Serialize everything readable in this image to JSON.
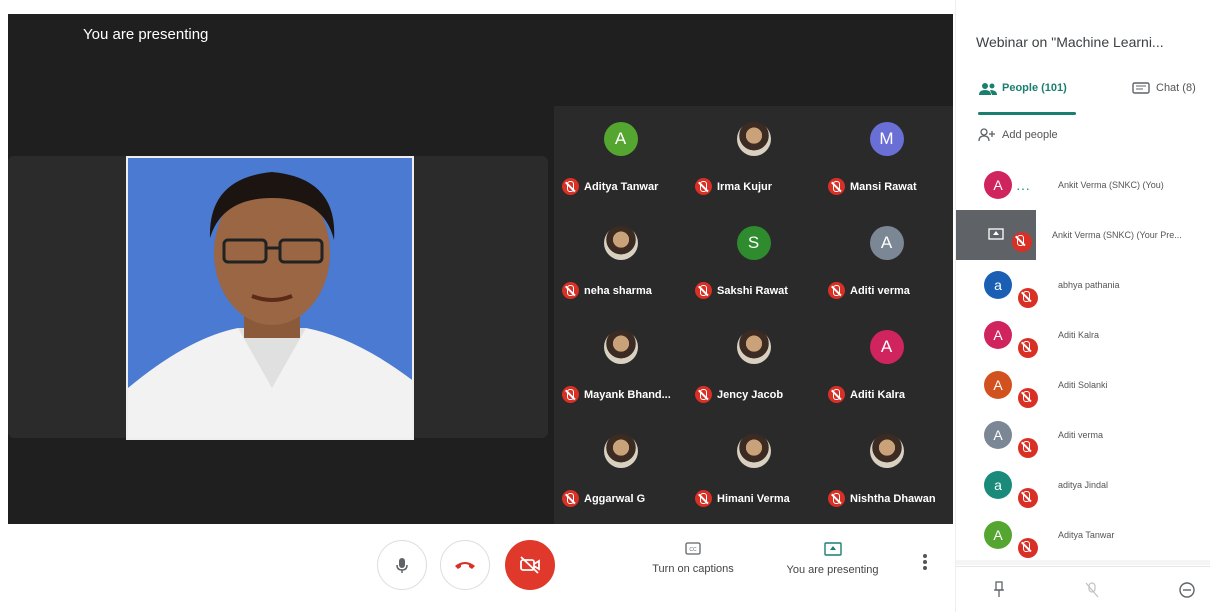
{
  "stage": {
    "presenting_label": "You are presenting",
    "tiles": [
      {
        "name": "Aditya Tanwar",
        "avatar": "A",
        "avatar_color": "#55a630",
        "photo": false
      },
      {
        "name": "Irma Kujur",
        "avatar": "",
        "avatar_color": "",
        "photo": true
      },
      {
        "name": "Mansi Rawat",
        "avatar": "M",
        "avatar_color": "#6a6fd6",
        "photo": false
      },
      {
        "name": "neha sharma",
        "avatar": "",
        "avatar_color": "",
        "photo": true
      },
      {
        "name": "Sakshi Rawat",
        "avatar": "S",
        "avatar_color": "#2e8b2e",
        "photo": false
      },
      {
        "name": "Aditi verma",
        "avatar": "A",
        "avatar_color": "#7b8794",
        "photo": false
      },
      {
        "name": "Mayank Bhand...",
        "avatar": "",
        "avatar_color": "",
        "photo": true
      },
      {
        "name": "Jency Jacob",
        "avatar": "",
        "avatar_color": "",
        "photo": true
      },
      {
        "name": "Aditi Kalra",
        "avatar": "A",
        "avatar_color": "#d0245e",
        "photo": false
      },
      {
        "name": "Aggarwal G",
        "avatar": "",
        "avatar_color": "",
        "photo": true
      },
      {
        "name": "Himani Verma",
        "avatar": "",
        "avatar_color": "",
        "photo": true
      },
      {
        "name": "Nishtha Dhawan",
        "avatar": "",
        "avatar_color": "",
        "photo": true
      }
    ]
  },
  "controls": {
    "mic_icon": "microphone-icon",
    "hangup_icon": "phone-hangup-icon",
    "camera_icon": "camera-off-icon",
    "captions_label": "Turn on captions",
    "present_label": "You are presenting",
    "more_icon": "more-vertical-icon"
  },
  "panel": {
    "title": "Webinar on \"Machine Learni...",
    "people_tab": "People (101)",
    "chat_tab": "Chat (8)",
    "add_people": "Add people",
    "accent": "#1a7f6f",
    "people": [
      {
        "name": "Ankit Verma (SNKC) (You)",
        "avatar": "A",
        "color": "#d0245e",
        "muted": false
      },
      {
        "name": "Ankit Verma (SNKC) (Your Pre...",
        "avatar": "",
        "color": "",
        "muted": true,
        "presentation": true
      },
      {
        "name": "abhya pathania",
        "avatar": "a",
        "color": "#1a5fb4",
        "muted": true
      },
      {
        "name": "Aditi Kalra",
        "avatar": "A",
        "color": "#d0245e",
        "muted": true
      },
      {
        "name": "Aditi Solanki",
        "avatar": "A",
        "color": "#d2521f",
        "muted": true
      },
      {
        "name": "Aditi verma",
        "avatar": "A",
        "color": "#7b8794",
        "muted": true
      },
      {
        "name": "aditya Jindal",
        "avatar": "a",
        "color": "#1a8a7a",
        "muted": true
      },
      {
        "name": "Aditya Tanwar",
        "avatar": "A",
        "color": "#55a630",
        "muted": true
      }
    ]
  }
}
